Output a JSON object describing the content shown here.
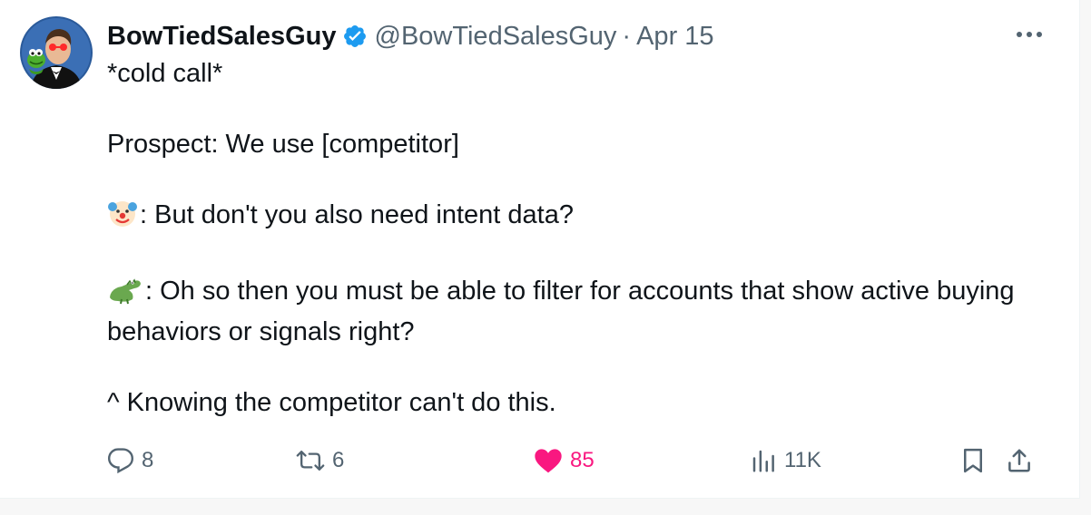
{
  "tweet": {
    "author": {
      "display_name": "BowTiedSalesGuy",
      "handle": "@BowTiedSalesGuy",
      "verified_icon": "verified-badge-icon",
      "avatar": "avatar-image"
    },
    "separator": "·",
    "date": "Apr 15",
    "more_icon": "more-dots-icon",
    "text": {
      "line1": "*cold call*",
      "line2": "Prospect: We use [competitor]",
      "line3_emoji": "clown-face-emoji",
      "line3": ": But don't you also need intent data?",
      "line4_emoji": "crocodile-emoji",
      "line4": ": Oh so then you must be able to filter for accounts that show active buying behaviors or signals right?",
      "line5": "^ Knowing the competitor can't do this."
    },
    "actions": {
      "replies": "8",
      "retweets": "6",
      "likes": "85",
      "views": "11K",
      "reply_icon": "reply-icon",
      "retweet_icon": "retweet-icon",
      "like_icon": "heart-icon",
      "views_icon": "views-chart-icon",
      "bookmark_icon": "bookmark-icon",
      "share_icon": "share-icon"
    },
    "colors": {
      "like_active": "#f91880",
      "verified": "#1d9bf0",
      "secondary_text": "#536471"
    }
  }
}
